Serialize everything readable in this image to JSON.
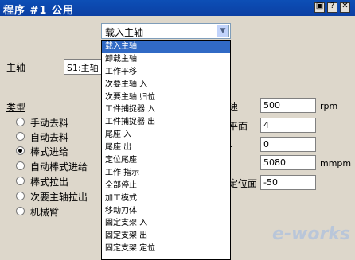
{
  "window": {
    "title": "程序 #1 公用"
  },
  "combo": {
    "value": "载入主轴"
  },
  "dropdown": {
    "items": [
      "载入主轴",
      "卸载主轴",
      "工作平移",
      "次要主轴 入",
      "次要主轴 归位",
      "工件捕捉器 入",
      "工件捕捉器 出",
      "尾座 入",
      "尾座 出",
      "定位尾座",
      "工作 指示",
      "全部停止",
      "加工模式",
      "移动刀体",
      "固定支架 入",
      "固定支架 出",
      "固定支架 定位"
    ]
  },
  "spindle": {
    "label": "主轴",
    "value": "S1:主轴"
  },
  "type": {
    "label": "类型",
    "options": [
      {
        "label": "手动去料",
        "selected": false
      },
      {
        "label": "自动去料",
        "selected": false
      },
      {
        "label": "棒式进给",
        "selected": true
      },
      {
        "label": "自动棒式进给",
        "selected": false
      },
      {
        "label": "棒式拉出",
        "selected": false
      },
      {
        "label": "次要主轴拉出",
        "selected": false
      },
      {
        "label": "机械臂",
        "selected": false
      }
    ]
  },
  "params": [
    {
      "label": "速",
      "value": "500",
      "unit": "rpm"
    },
    {
      "label": "平面",
      "value": "4",
      "unit": ""
    },
    {
      "label": "t",
      "value": "0",
      "unit": ""
    },
    {
      "label": "",
      "value": "5080",
      "unit": "mmpm"
    },
    {
      "label": "定位面",
      "value": "-50",
      "unit": ""
    }
  ],
  "watermark": "e-works"
}
